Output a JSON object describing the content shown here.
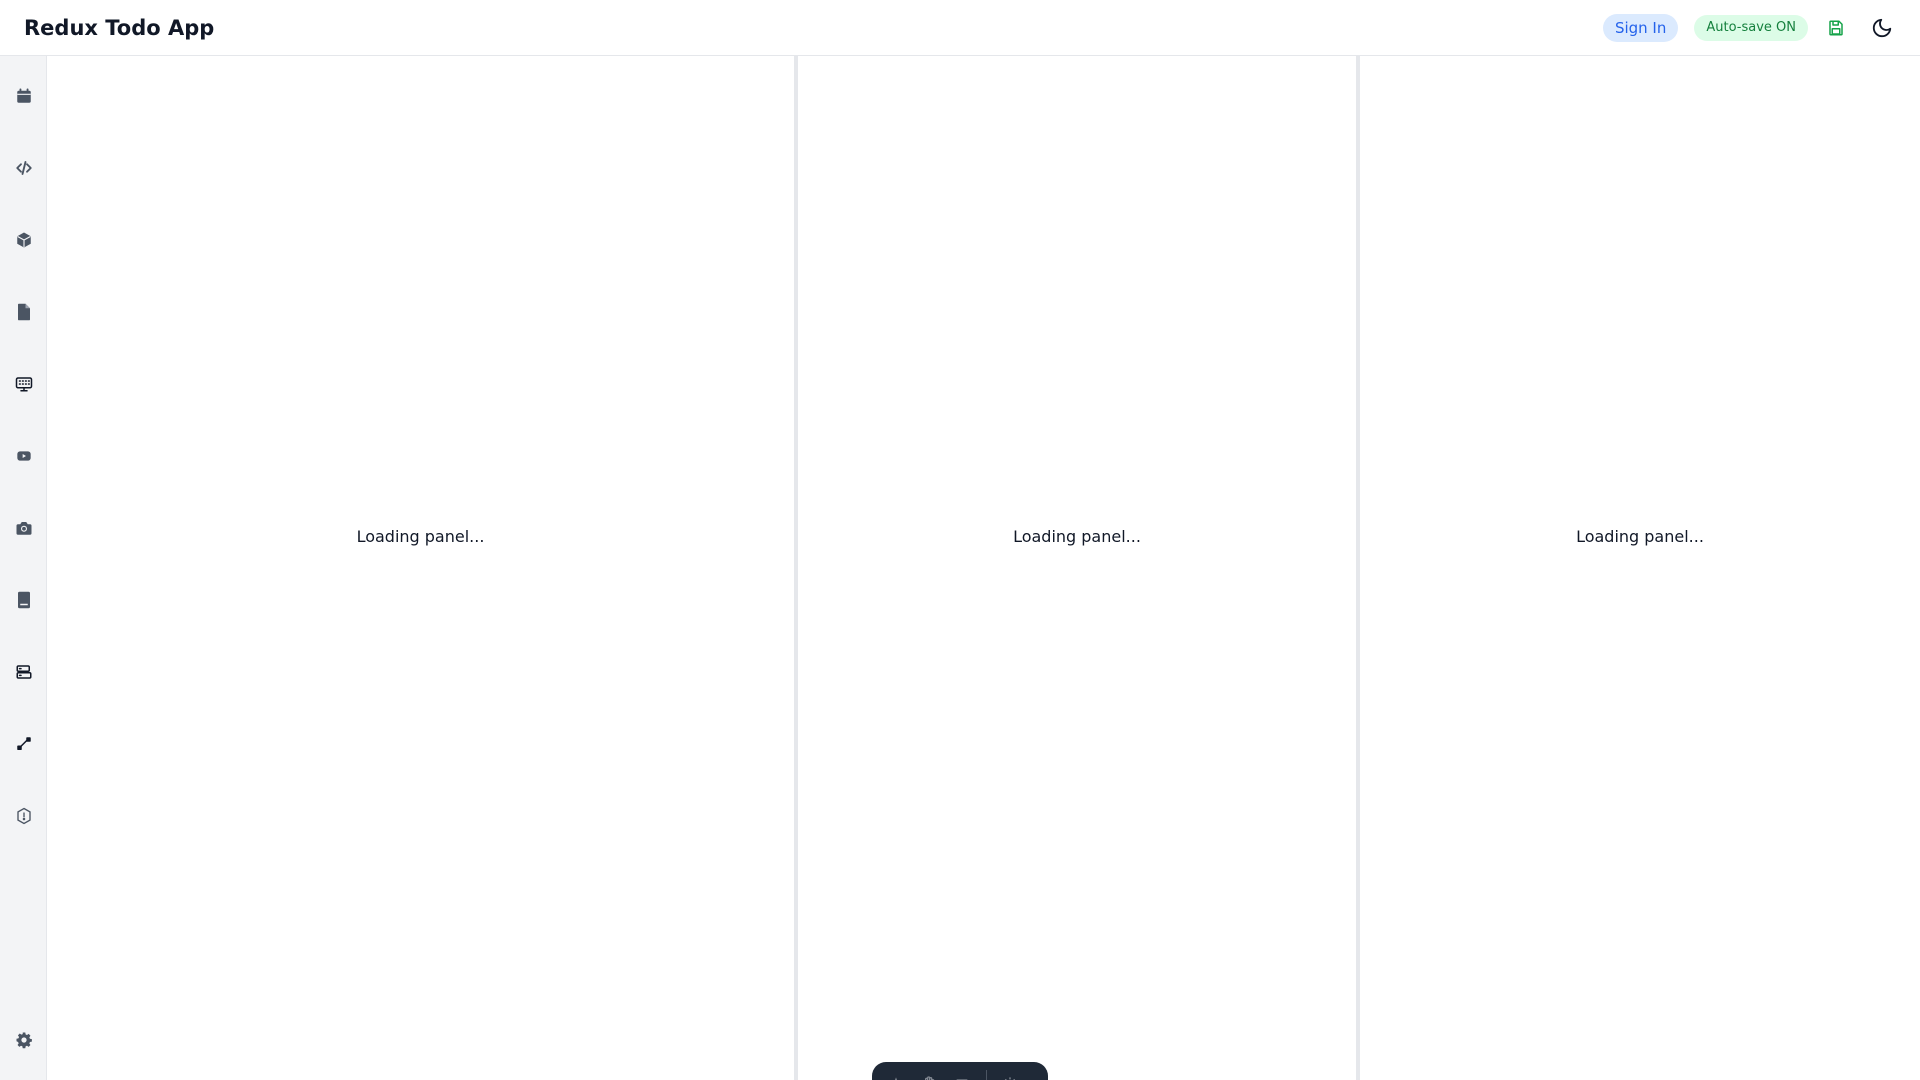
{
  "header": {
    "title": "Redux Todo App",
    "sign_in_label": "Sign In",
    "autosave_label": "Auto-save ON",
    "save_icon": "save-icon",
    "theme_icon": "moon-icon"
  },
  "sidebar": {
    "items": [
      {
        "icon": "calendar-icon"
      },
      {
        "icon": "code-icon"
      },
      {
        "icon": "cube-icon"
      },
      {
        "icon": "file-icon"
      },
      {
        "icon": "keyboard-icon"
      },
      {
        "icon": "video-icon"
      },
      {
        "icon": "camera-icon"
      },
      {
        "icon": "book-icon"
      },
      {
        "icon": "database-icon"
      },
      {
        "icon": "diagram-icon"
      },
      {
        "icon": "shield-icon"
      }
    ],
    "settings_icon": "gear-icon"
  },
  "panels": [
    {
      "text": "Loading panel..."
    },
    {
      "text": "Loading panel..."
    },
    {
      "text": "Loading panel..."
    }
  ],
  "colors": {
    "accent": "#2563eb",
    "success": "#15803d",
    "sidebar_bg": "#f3f4f6",
    "icon": "#4b5563"
  }
}
